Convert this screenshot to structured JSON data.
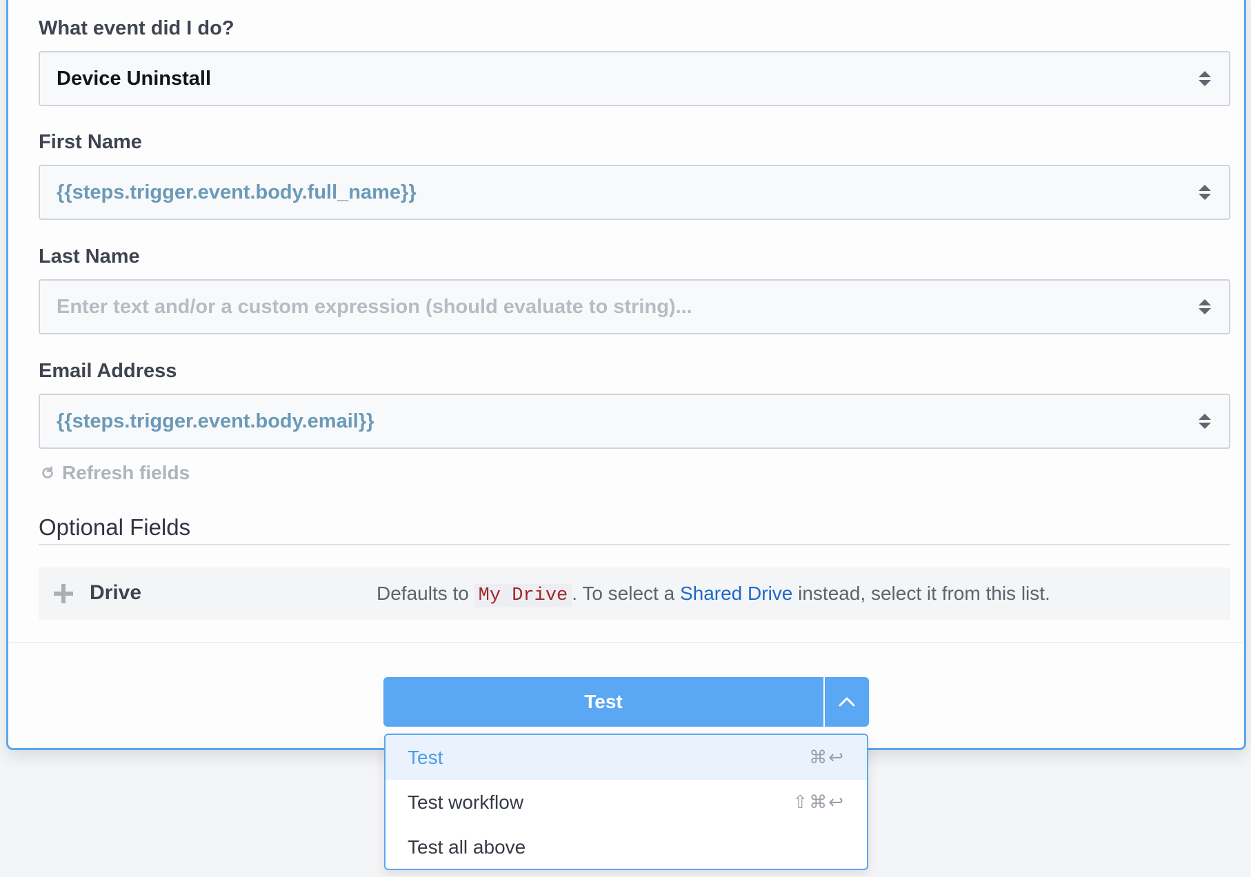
{
  "form": {
    "event": {
      "label": "What event did I do?",
      "value": "Device Uninstall"
    },
    "first_name": {
      "label": "First Name",
      "value": "{{steps.trigger.event.body.full_name}}"
    },
    "last_name": {
      "label": "Last Name",
      "placeholder": "Enter text and/or a custom expression (should evaluate to string)..."
    },
    "email": {
      "label": "Email Address",
      "value": "{{steps.trigger.event.body.email}}"
    }
  },
  "refresh": {
    "label": "Refresh fields",
    "icon": "refresh-icon"
  },
  "optional": {
    "title": "Optional Fields",
    "drive": {
      "label": "Drive",
      "desc_prefix": "Defaults to",
      "desc_code": "My Drive",
      "desc_mid": ". To select a",
      "desc_link": "Shared Drive",
      "desc_suffix": "instead, select it from this list."
    }
  },
  "actions": {
    "test_label": "Test",
    "menu": [
      {
        "label": "Test",
        "shortcut": "⌘↩"
      },
      {
        "label": "Test workflow",
        "shortcut": "⇧⌘↩"
      },
      {
        "label": "Test all above",
        "shortcut": ""
      }
    ]
  },
  "colors": {
    "accent": "#5aa7f4",
    "expression": "#6a9ab8",
    "link": "#1e69c8",
    "code": "#a3262b"
  }
}
